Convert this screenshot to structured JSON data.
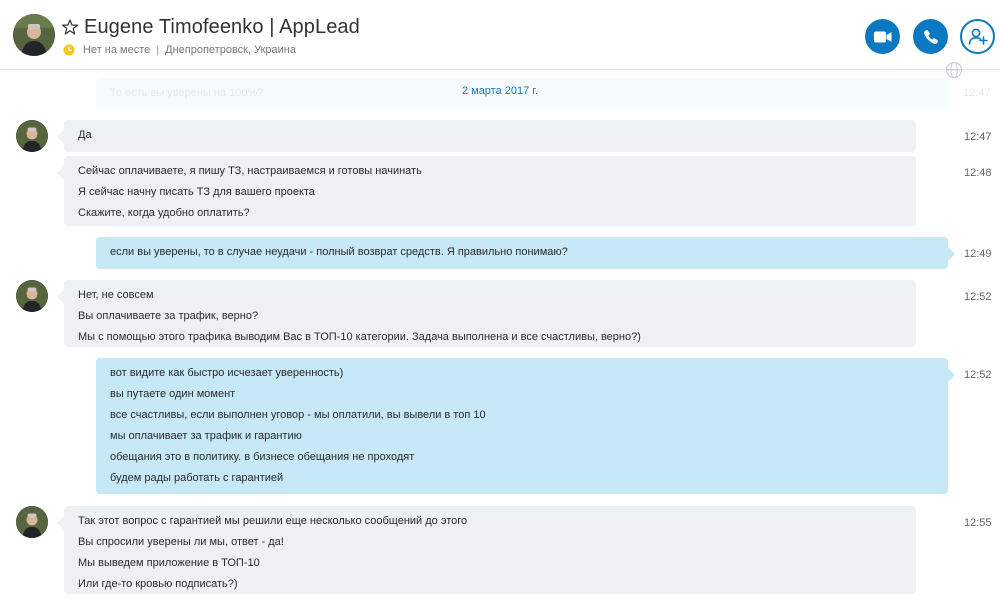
{
  "header": {
    "contact_name": "Eugene Timofeenko | AppLead",
    "status": "Нет на месте",
    "separator": "|",
    "location": "Днепропетровск, Украина"
  },
  "faded_message": {
    "text": "То есть вы уверены на 100%?",
    "time": "12:47"
  },
  "date_separator": "2 марта 2017 г.",
  "messages": [
    {
      "direction": "in",
      "time": "12:47",
      "lines": [
        "Да"
      ]
    },
    {
      "direction": "in",
      "time": "12:48",
      "lines": [
        "Сейчас оплачиваете, я пишу ТЗ, настраиваемся и готовы начинать",
        "Я сейчас начну писать ТЗ для вашего проекта",
        "Скажите, когда удобно оплатить?"
      ]
    },
    {
      "direction": "out",
      "time": "12:49",
      "lines": [
        "если вы уверены, то в случае неудачи - полный возврат средств. Я правильно понимаю?"
      ]
    },
    {
      "direction": "in",
      "time": "12:52",
      "lines": [
        "Нет, не совсем",
        "Вы оплачиваете за трафик, верно?",
        "Мы с помощью этого трафика выводим Вас в ТОП-10 категории. Задача выполнена и все счастливы, верно?)"
      ]
    },
    {
      "direction": "out",
      "time": "12:52",
      "lines": [
        "вот видите как быстро исчезает уверенность)",
        "вы путаете один момент",
        "все счастливы, если выполнен уговор - мы оплатили, вы вывели в топ 10",
        "мы оплачивает за трафик и гарантию",
        "обещания это в политику. в бизнесе обещания не проходят",
        "будем рады работать с гарантией"
      ]
    },
    {
      "direction": "in",
      "time": "12:55",
      "lines": [
        "Так этот вопрос с гарантией мы решили еще несколько сообщений до этого",
        "Вы спросили уверены ли мы, ответ - да!",
        "Мы выведем приложение в ТОП-10",
        "Или где-то кровью подписать?)"
      ]
    }
  ],
  "colors": {
    "accent": "#0b78c2",
    "incoming_bubble": "#eef1f4",
    "outgoing_bubble": "#c7e8f7",
    "away_status": "#f5c518"
  },
  "icons": {
    "favorite": "star-icon",
    "status": "away-clock-icon",
    "video": "video-call-icon",
    "audio": "phone-icon",
    "add": "add-person-icon",
    "translate": "globe-icon"
  }
}
